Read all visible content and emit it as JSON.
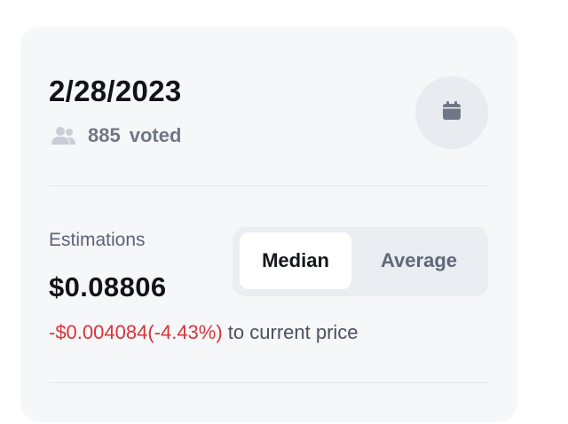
{
  "header": {
    "date": "2/28/2023",
    "votes_count": "885",
    "votes_label": "voted"
  },
  "icons": {
    "people": "people-icon",
    "calendar": "calendar-icon"
  },
  "estimation": {
    "label": "Estimations",
    "price": "$0.08806",
    "diff_value": "-$0.004084(-4.43%)",
    "diff_suffix": " to current price"
  },
  "toggle": {
    "options": [
      "Median",
      "Average"
    ],
    "selected": "Median"
  },
  "colors": {
    "negative": "#d8343a",
    "card_bg": "#f6f7f9"
  }
}
